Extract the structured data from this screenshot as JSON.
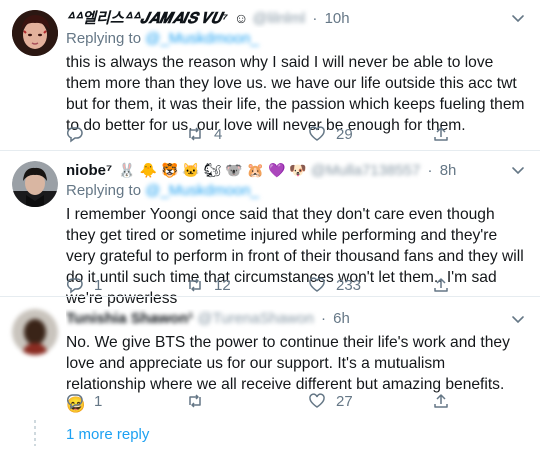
{
  "tweets": [
    {
      "display_name": "ᐞᐞ엘리스ᐞᐞ𝑱𝑨𝑴𝑨𝑰𝑺 𝑽𝑼⁷",
      "emoji": "☺",
      "handle": "@lilnlml",
      "time": "10h",
      "replying_prefix": "Replying to",
      "replying_handle": "@_Muskdmoon_",
      "text": "this is always the reason why I said I will never be able to love them more than they love us. we have our life outside this acc twt but for them, it was their life, the passion which keeps fueling them to do better for us. our love will never be enough for them.",
      "replies": "",
      "retweets": "4",
      "likes": "29"
    },
    {
      "display_name": "niobe⁷",
      "emoji": "🐰 🐥 🐯 🐱 🐿 🐨 🐹 💜 🐶",
      "handle": "@Mulla7138557",
      "time": "8h",
      "replying_prefix": "Replying to",
      "replying_handle": "@_Muskdmoon_",
      "text": "I remember Yoongi once said that they don't care even though they get tired or sometime injured while performing and they're very grateful to perform in front of their thousand fans and they will do it until such time that circumstances won't let them.. I'm sad we're powerless",
      "replies": "1",
      "retweets": "12",
      "likes": "233"
    },
    {
      "display_name": "Tunishia Shawon¹",
      "emoji": "",
      "handle": "@TurenaShawon",
      "time": "6h",
      "replying_prefix": "",
      "replying_handle": "",
      "text": "No. We give BTS the power to continue their life's work and they love and appreciate us for our support. It's a mutualism relationship where we all receive different but amazing benefits. 😄",
      "replies": "1",
      "retweets": "",
      "likes": "27"
    }
  ],
  "more_replies": "1 more reply",
  "colors": {
    "accent": "#1da1f2",
    "muted": "#657786",
    "divider": "#e6ecf0"
  },
  "icons": [
    "reply-icon",
    "retweet-icon",
    "like-icon",
    "share-icon",
    "caret-down-icon"
  ]
}
